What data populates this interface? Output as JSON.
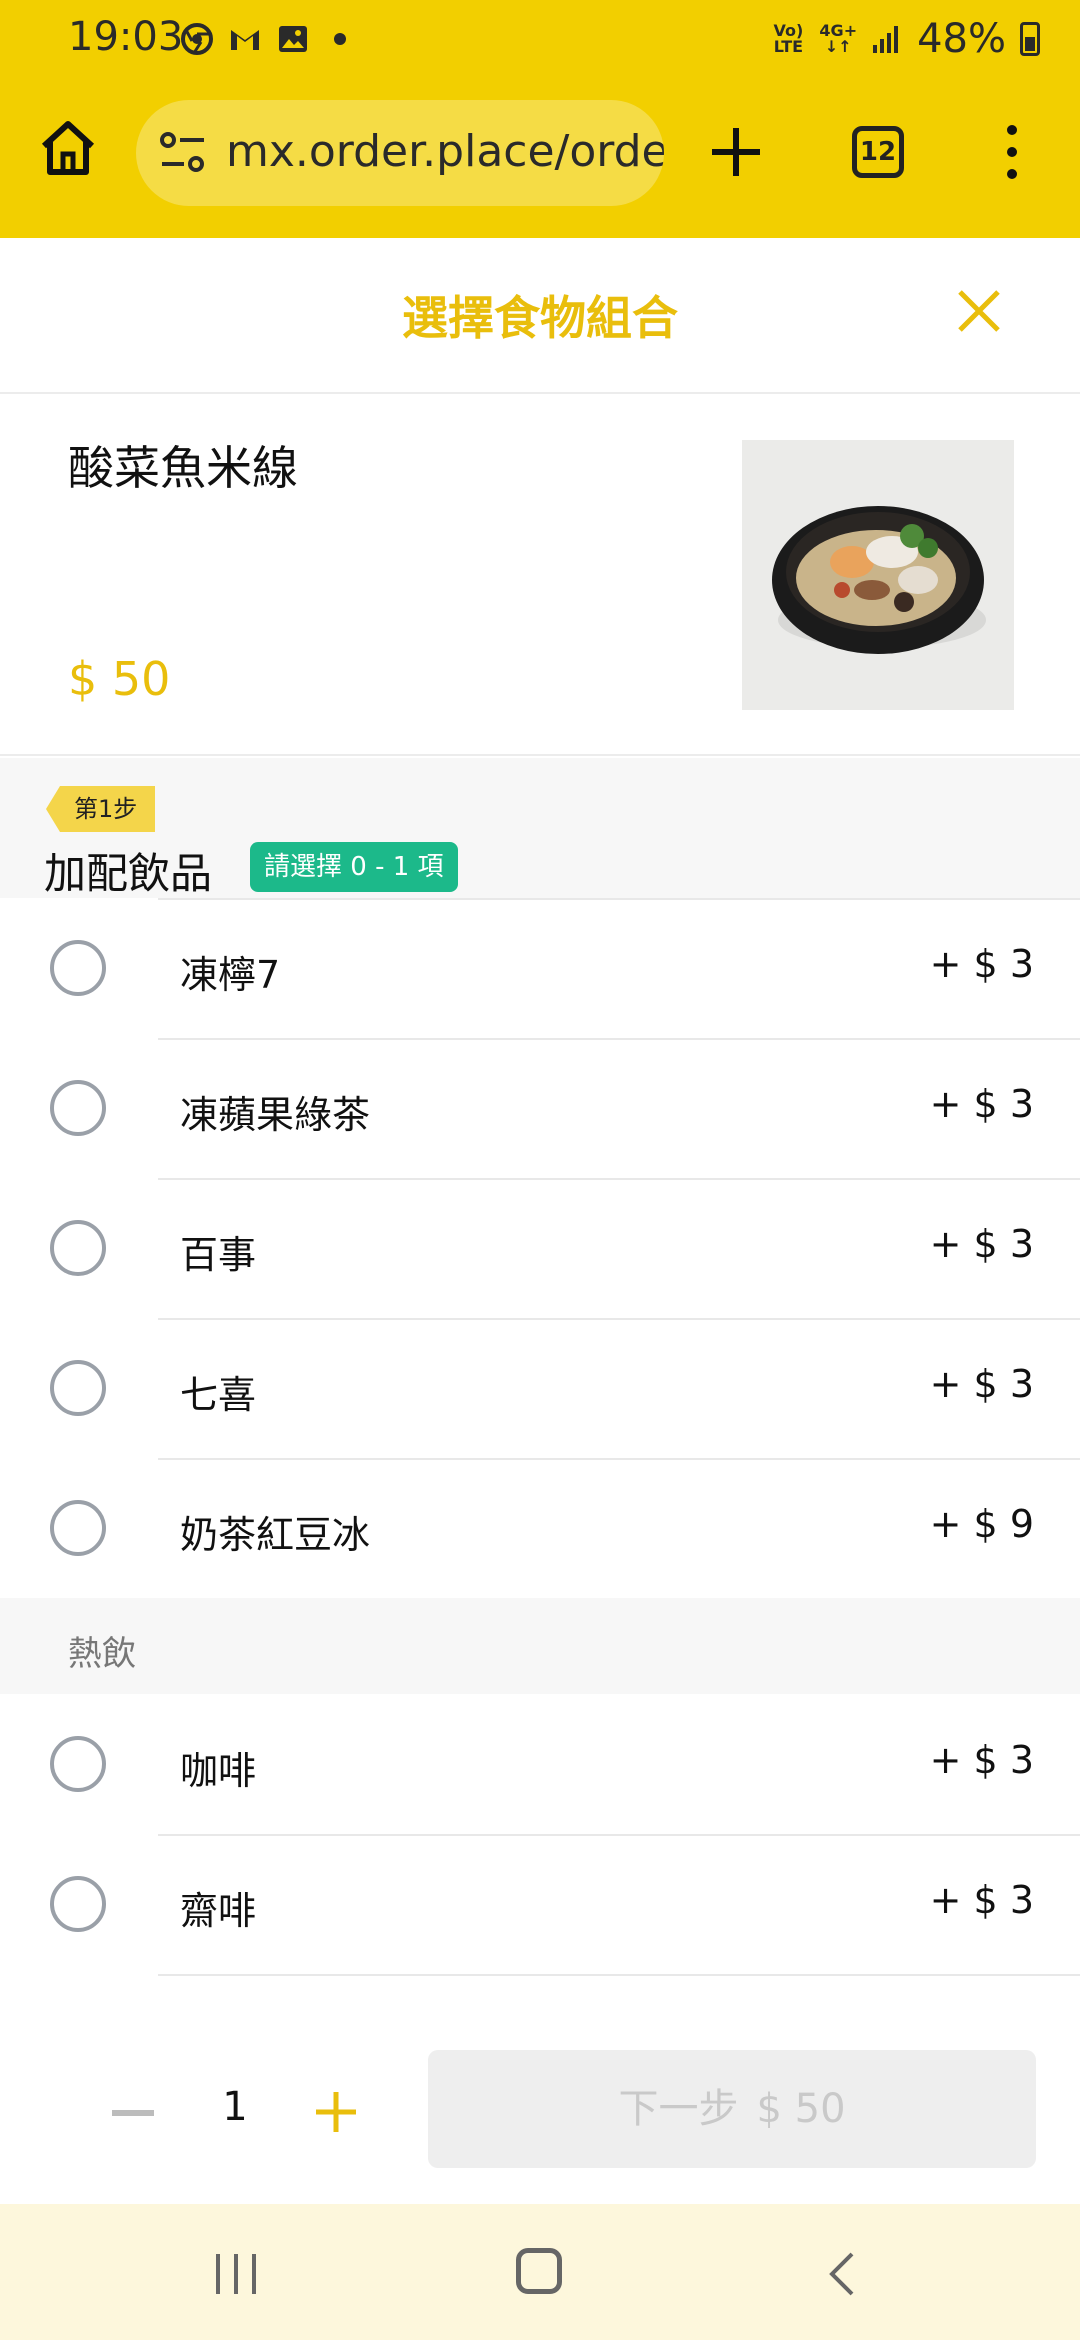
{
  "status_bar": {
    "time": "19:03",
    "network_top": "Vo) LTE",
    "network_mid": "4G+",
    "battery": "48%",
    "icons": [
      "chrome-icon",
      "gmail-icon",
      "gallery-icon",
      "dot-icon",
      "volte-icon",
      "4g-icon",
      "signal-icon",
      "battery-icon"
    ]
  },
  "browser": {
    "url": "mx.order.place/order",
    "tab_count": "12",
    "accent_color": "#f2cf00"
  },
  "modal": {
    "title": "選擇食物組合"
  },
  "product": {
    "name": "酸菜魚米線",
    "price": "$ 50"
  },
  "step": {
    "tag": "第1步",
    "title": "加配飲品",
    "badge": "請選擇 0 - 1 項",
    "badge_color": "#1cb98a"
  },
  "options_cold": [
    {
      "name": "凍檸7",
      "price": "+ $ 3"
    },
    {
      "name": "凍蘋果綠茶",
      "price": "+ $ 3"
    },
    {
      "name": "百事",
      "price": "+ $ 3"
    },
    {
      "name": "七喜",
      "price": "+ $ 3"
    },
    {
      "name": "奶茶紅豆冰",
      "price": "+ $ 9"
    }
  ],
  "group_hot": {
    "label": "熱飲"
  },
  "options_hot": [
    {
      "name": "咖啡",
      "price": "+ $ 3"
    },
    {
      "name": "齋啡",
      "price": "+ $ 3"
    }
  ],
  "action_bar": {
    "quantity": "1",
    "next_label": "下一步",
    "next_price": "$ 50"
  }
}
